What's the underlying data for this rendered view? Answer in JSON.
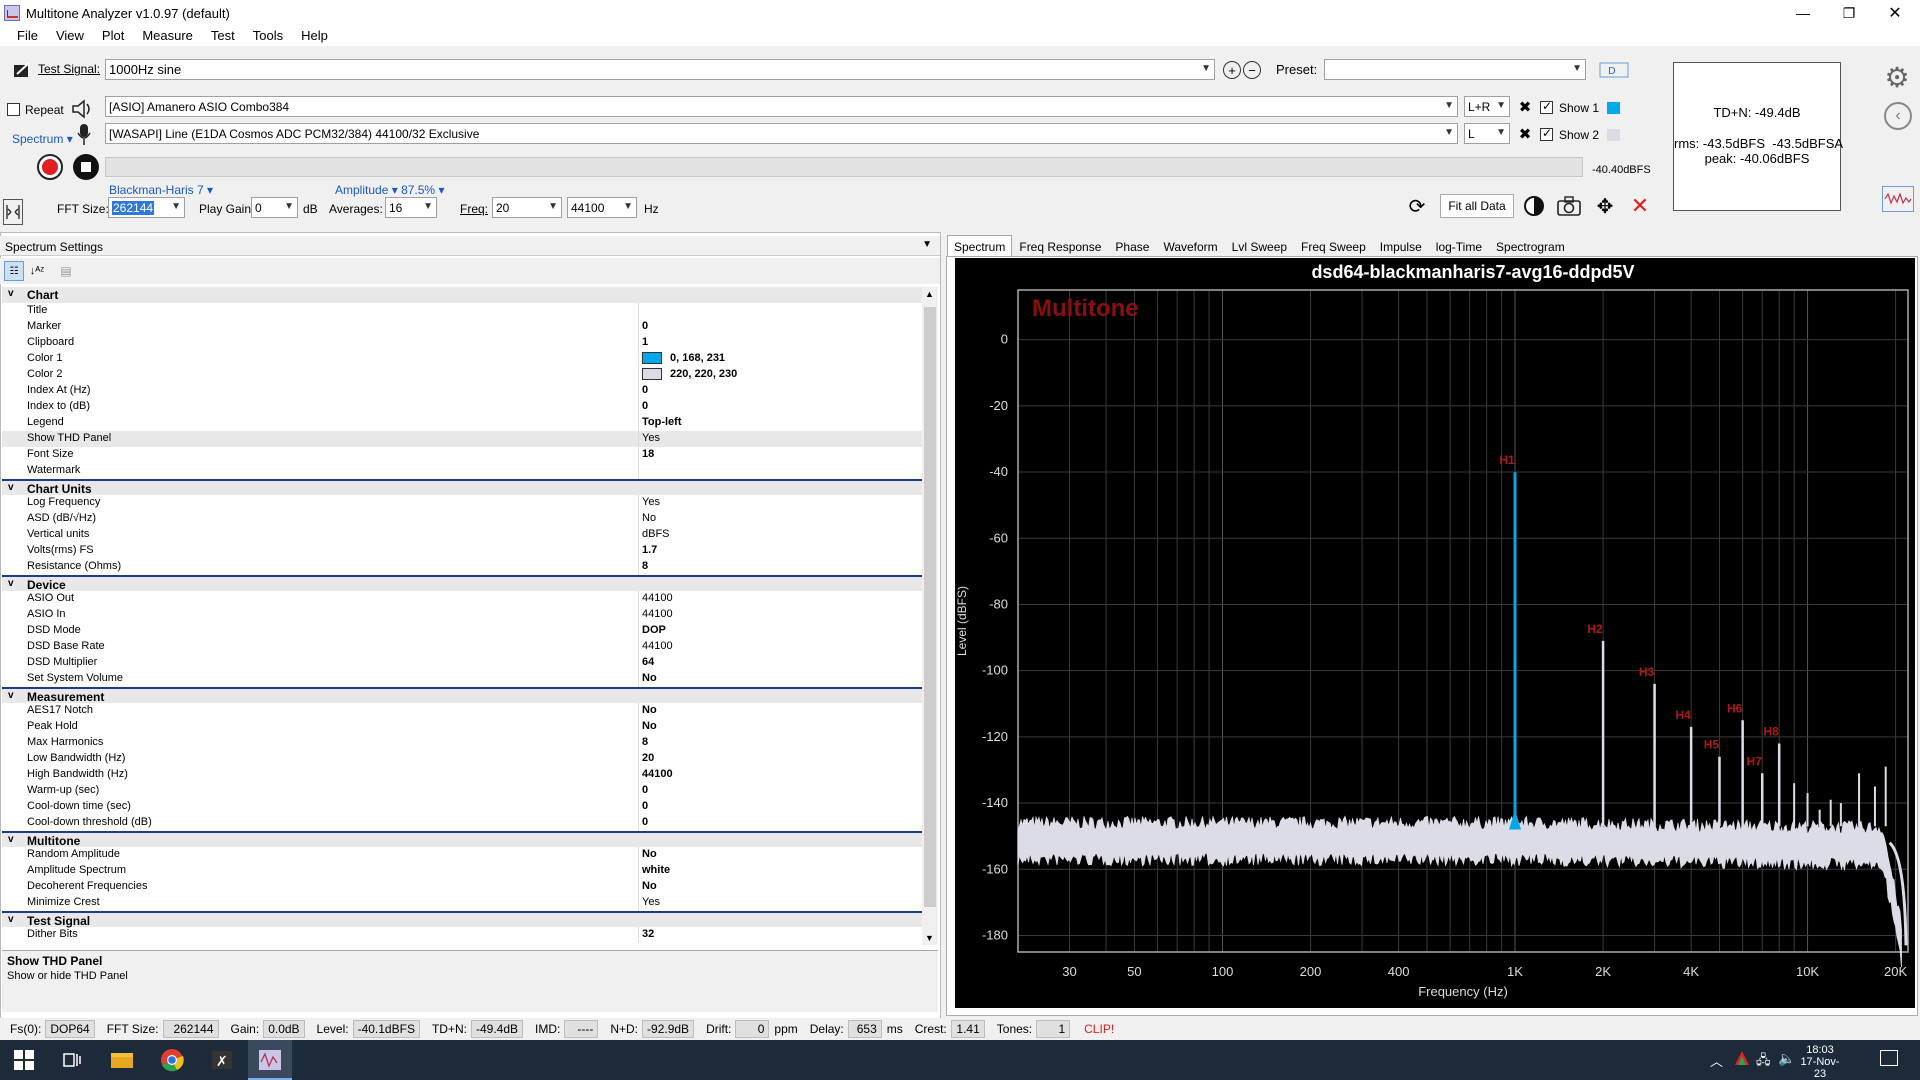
{
  "window": {
    "title": "Multitone Analyzer v1.0.97 (default)"
  },
  "menu": [
    "File",
    "View",
    "Plot",
    "Measure",
    "Test",
    "Tools",
    "Help"
  ],
  "signal": {
    "label": "Test Signal:",
    "value": "1000Hz sine",
    "preset_label": "Preset:",
    "preset_value": ""
  },
  "output": {
    "repeat_label": "Repeat",
    "device": "[ASIO] Amanero ASIO Combo384",
    "channel": "L+R",
    "show1": "Show 1"
  },
  "input": {
    "spectrum_label": "Spectrum",
    "device": "[WASAPI] Line (E1DA Cosmos ADC PCM32/384) 44100/32 Exclusive",
    "channel": "L",
    "show2": "Show 2",
    "level": "-40.40dBFS"
  },
  "controls": {
    "window_fn": "Blackman-Haris 7",
    "amplitude": "Amplitude",
    "amplitude_pct": "87.5%",
    "fft_label": "FFT Size:",
    "fft_value": "262144",
    "gain_label": "Play Gain:",
    "gain_value": "0",
    "db_label": "dB",
    "avg_label": "Averages:",
    "avg_value": "16",
    "freq_label": "Freq:",
    "freq_value": "20",
    "freq_max": "44100",
    "hz_label": "Hz",
    "fit_label": "Fit all Data"
  },
  "status_panel": {
    "tdn": "TD+N: -49.4dB",
    "rms": "rms: -43.5dBFS  -43.5dBFSA",
    "peak": "peak: -40.06dBFS"
  },
  "settings": {
    "header": "Spectrum Settings",
    "rows": [
      {
        "t": "cat",
        "n": "Chart"
      },
      {
        "n": "Title",
        "v": ""
      },
      {
        "n": "Marker",
        "v": "0",
        "b": 1
      },
      {
        "n": "Clipboard",
        "v": "1",
        "b": 1
      },
      {
        "n": "Color 1",
        "v": "0, 168, 231",
        "b": 1,
        "sw": "#00a8e7"
      },
      {
        "n": "Color 2",
        "v": "220, 220, 230",
        "b": 1,
        "sw": "#dcdce6"
      },
      {
        "n": "Index At (Hz)",
        "v": "0",
        "b": 1
      },
      {
        "n": "Index to (dB)",
        "v": "0",
        "b": 1
      },
      {
        "n": "Legend",
        "v": "Top-left",
        "b": 1
      },
      {
        "n": "Show THD Panel",
        "v": "Yes",
        "sel": 1
      },
      {
        "n": "Font Size",
        "v": "18",
        "b": 1
      },
      {
        "n": "Watermark",
        "v": ""
      },
      {
        "t": "cat",
        "n": "Chart Units"
      },
      {
        "n": "Log Frequency",
        "v": "Yes"
      },
      {
        "n": "ASD (dB/√Hz)",
        "v": "No"
      },
      {
        "n": "Vertical units",
        "v": "dBFS"
      },
      {
        "n": "Volts(rms) FS",
        "v": "1.7",
        "b": 1
      },
      {
        "n": "Resistance (Ohms)",
        "v": "8",
        "b": 1
      },
      {
        "t": "cat",
        "n": "Device"
      },
      {
        "n": "ASIO Out",
        "v": "44100"
      },
      {
        "n": "ASIO In",
        "v": "44100"
      },
      {
        "n": "DSD Mode",
        "v": "DOP",
        "b": 1
      },
      {
        "n": "DSD Base Rate",
        "v": "44100"
      },
      {
        "n": "DSD Multiplier",
        "v": "64",
        "b": 1
      },
      {
        "n": "Set System Volume",
        "v": "No",
        "b": 1
      },
      {
        "t": "cat",
        "n": "Measurement"
      },
      {
        "n": "AES17 Notch",
        "v": "No",
        "b": 1
      },
      {
        "n": "Peak Hold",
        "v": "No",
        "b": 1
      },
      {
        "n": "Max Harmonics",
        "v": "8",
        "b": 1
      },
      {
        "n": "Low Bandwidth (Hz)",
        "v": "20",
        "b": 1
      },
      {
        "n": "High Bandwidth (Hz)",
        "v": "44100",
        "b": 1
      },
      {
        "n": "Warm-up (sec)",
        "v": "0",
        "b": 1
      },
      {
        "n": "Cool-down time (sec)",
        "v": "0",
        "b": 1
      },
      {
        "n": "Cool-down threshold (dB)",
        "v": "0",
        "b": 1
      },
      {
        "t": "cat",
        "n": "Multitone"
      },
      {
        "n": "Random Amplitude",
        "v": "No",
        "b": 1
      },
      {
        "n": "Amplitude Spectrum",
        "v": "white",
        "b": 1
      },
      {
        "n": "Decoherent Frequencies",
        "v": "No",
        "b": 1
      },
      {
        "n": "Minimize Crest",
        "v": "Yes"
      },
      {
        "t": "cat",
        "n": "Test Signal"
      },
      {
        "n": "Dither Bits",
        "v": "32",
        "b": 1
      }
    ],
    "desc_title": "Show THD Panel",
    "desc_text": "Show or hide THD Panel"
  },
  "tabs": [
    "Spectrum",
    "Freq Response",
    "Phase",
    "Waveform",
    "Lvl Sweep",
    "Freq Sweep",
    "Impulse",
    "log-Time",
    "Spectrogram"
  ],
  "chart_data": {
    "type": "line",
    "title": "dsd64-blackmanharis7-avg16-ddpd5V",
    "watermark": "Multitone",
    "xlabel": "Frequency (Hz)",
    "ylabel": "Level (dBFS)",
    "xscale": "log",
    "xlim": [
      20,
      22050
    ],
    "ylim": [
      -185,
      15
    ],
    "xticks": [
      30,
      50,
      100,
      200,
      400,
      1000,
      2000,
      4000,
      10000,
      20000
    ],
    "xticklabels": [
      "30",
      "50",
      "100",
      "200",
      "400",
      "1K",
      "2K",
      "4K",
      "10K",
      "20K"
    ],
    "yticks": [
      0,
      -20,
      -40,
      -60,
      -80,
      -100,
      -120,
      -140,
      -160,
      -180
    ],
    "grid": true,
    "series": [
      {
        "color": "#dcdce6",
        "noise_floor_db": -150
      },
      {
        "color": "#00a8e7",
        "peak_x": 1000,
        "peak_db": -40.06
      }
    ],
    "harmonics": [
      {
        "label": "H1",
        "x": 1000,
        "db": -40
      },
      {
        "label": "H2",
        "x": 2000,
        "db": -91
      },
      {
        "label": "H3",
        "x": 3000,
        "db": -104
      },
      {
        "label": "H4",
        "x": 4000,
        "db": -117
      },
      {
        "label": "H5",
        "x": 5000,
        "db": -126
      },
      {
        "label": "H6",
        "x": 6000,
        "db": -115
      },
      {
        "label": "H7",
        "x": 7000,
        "db": -131
      },
      {
        "label": "H8",
        "x": 8000,
        "db": -122
      }
    ],
    "extra_spurs": [
      {
        "x": 9000,
        "db": -134
      },
      {
        "x": 10000,
        "db": -137
      },
      {
        "x": 11000,
        "db": -142
      },
      {
        "x": 12000,
        "db": -139
      },
      {
        "x": 13000,
        "db": -140
      },
      {
        "x": 15000,
        "db": -131
      },
      {
        "x": 17000,
        "db": -135
      },
      {
        "x": 18500,
        "db": -129
      }
    ]
  },
  "statusbar": [
    {
      "l": "Fs(0):",
      "v": "DOP64"
    },
    {
      "l": "FFT Size:",
      "v": "262144"
    },
    {
      "l": "Gain:",
      "v": "0.0dB"
    },
    {
      "l": "Level:",
      "v": "-40.1dBFS"
    },
    {
      "l": "TD+N:",
      "v": "-49.4dB"
    },
    {
      "l": "IMD:",
      "v": "----"
    },
    {
      "l": "N+D:",
      "v": "-92.9dB"
    },
    {
      "l": "Drift:",
      "v": "0",
      "u": "ppm"
    },
    {
      "l": "Delay:",
      "v": "653",
      "u": "ms"
    },
    {
      "l": "Crest:",
      "v": "1.41"
    },
    {
      "l": "Tones:",
      "v": "1"
    }
  ],
  "clip": "CLIP!",
  "taskbar": {
    "time": "18:03",
    "date": "17-Nov-23"
  }
}
